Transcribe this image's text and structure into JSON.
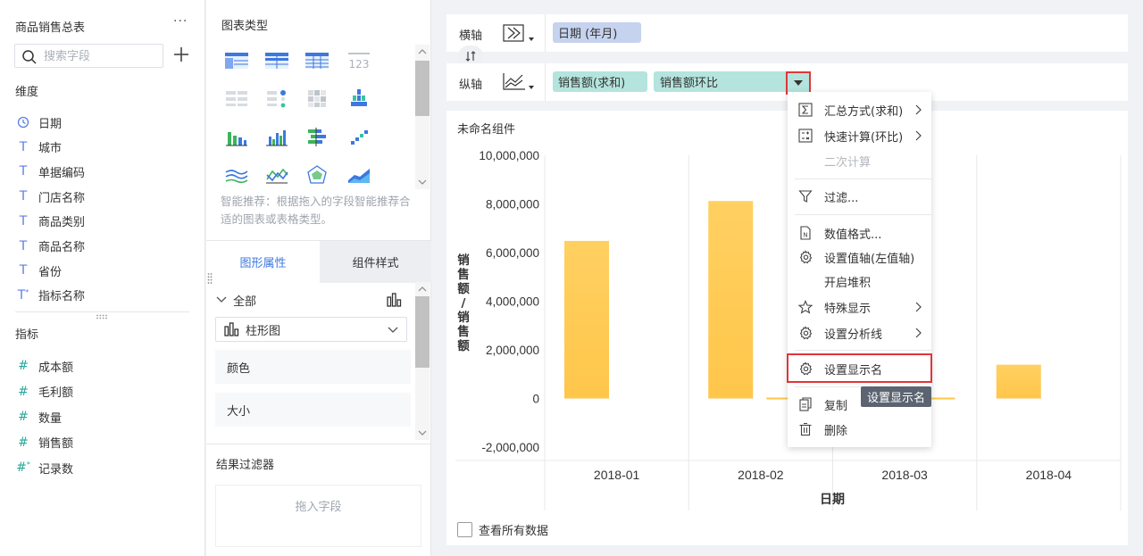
{
  "fields_panel": {
    "title": "商品销售总表",
    "more": "···",
    "search_placeholder": "搜索字段",
    "dimensions_label": "维度",
    "dimensions": [
      {
        "label": "日期",
        "icon": "clock-icon"
      },
      {
        "label": "城市",
        "icon": "text-field-icon"
      },
      {
        "label": "单据编码",
        "icon": "text-field-icon"
      },
      {
        "label": "门店名称",
        "icon": "text-field-icon"
      },
      {
        "label": "商品类别",
        "icon": "text-field-icon"
      },
      {
        "label": "商品名称",
        "icon": "text-field-icon"
      },
      {
        "label": "省份",
        "icon": "text-field-icon"
      },
      {
        "label": "指标名称",
        "icon": "text-field-calc-icon"
      }
    ],
    "measures_label": "指标",
    "measures": [
      {
        "label": "成本额",
        "icon": "hash-icon"
      },
      {
        "label": "毛利额",
        "icon": "hash-icon"
      },
      {
        "label": "数量",
        "icon": "hash-icon"
      },
      {
        "label": "销售额",
        "icon": "hash-icon"
      },
      {
        "label": "记录数",
        "icon": "hash-calc-icon"
      }
    ]
  },
  "chart_type_panel": {
    "title": "图表类型",
    "hint": "智能推荐：根据拖入的字段智能推荐合适的图表或表格类型。",
    "tabs": [
      "图形属性",
      "组件样式"
    ],
    "all_label": "全部",
    "chart_select": "柱形图",
    "props": [
      "颜色",
      "大小"
    ],
    "result_filter_title": "结果过滤器",
    "drop_hint": "拖入字段"
  },
  "axes": {
    "x_label": "横轴",
    "y_label": "纵轴",
    "x_pills": [
      "日期 (年月)"
    ],
    "y_pills": [
      "销售额(求和)",
      "销售额环比"
    ]
  },
  "chart_card": {
    "title": "未命名组件",
    "show_all": "查看所有数据"
  },
  "chart_data": {
    "type": "bar",
    "categories": [
      "2018-01",
      "2018-02",
      "2018-03",
      "2018-04"
    ],
    "series": [
      {
        "name": "销售额(求和)",
        "values": [
          6480000,
          8120000,
          0,
          1390000
        ]
      },
      {
        "name": "销售额环比",
        "values": [
          null,
          0.25,
          -1,
          null
        ]
      }
    ],
    "yticks": [
      "10,000,000",
      "8,000,000",
      "6,000,000",
      "4,000,000",
      "2,000,000",
      "0",
      "-2,000,000"
    ],
    "ylim": [
      -2000000,
      10000000
    ],
    "xlabel": "日期",
    "ylabel": "销售额/销售额",
    "colors": {
      "bar": "#ffc64a",
      "bar_top": "#ffd061",
      "grid": "#e8e8e8",
      "accent": "#3c78e0",
      "highlight": "#e0363a"
    }
  },
  "menu": {
    "items": [
      {
        "label": "汇总方式(求和)",
        "icon": "sum-icon",
        "submenu": true
      },
      {
        "label": "快速计算(环比)",
        "icon": "calc-icon",
        "submenu": true
      },
      {
        "label": "二次计算",
        "icon": "",
        "disabled": true
      },
      {
        "label": "过滤...",
        "icon": "filter-icon"
      },
      {
        "label": "数值格式...",
        "icon": "number-format-icon"
      },
      {
        "label": "设置值轴(左值轴)",
        "icon": "gear-icon"
      },
      {
        "label": "开启堆积",
        "icon": ""
      },
      {
        "label": "特殊显示",
        "icon": "star-icon",
        "submenu": true
      },
      {
        "label": "设置分析线",
        "icon": "gear-icon",
        "submenu": true
      },
      {
        "label": "设置显示名",
        "icon": "gear-icon"
      },
      {
        "label": "复制",
        "icon": "copy-icon"
      },
      {
        "label": "删除",
        "icon": "trash-icon"
      }
    ],
    "tooltip": "设置显示名"
  }
}
